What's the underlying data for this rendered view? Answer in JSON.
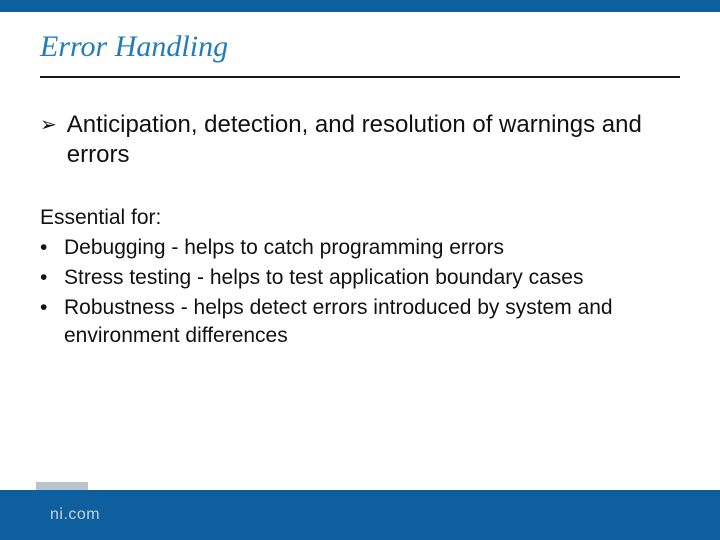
{
  "slide": {
    "title": "Error Handling",
    "lead_bullet_icon": "➢",
    "lead": "Anticipation, detection, and resolution of warnings and errors",
    "sub_heading": "Essential for:",
    "sub_items": [
      "Debugging - helps to catch programming errors",
      "Stress testing - helps to test application boundary cases",
      "Robustness - helps detect errors introduced by system and environment differences"
    ],
    "sub_bullet_glyph": "•"
  },
  "footer": {
    "brand": "ni.com"
  },
  "colors": {
    "accent": "#0d5f9e",
    "title": "#237bb8"
  }
}
